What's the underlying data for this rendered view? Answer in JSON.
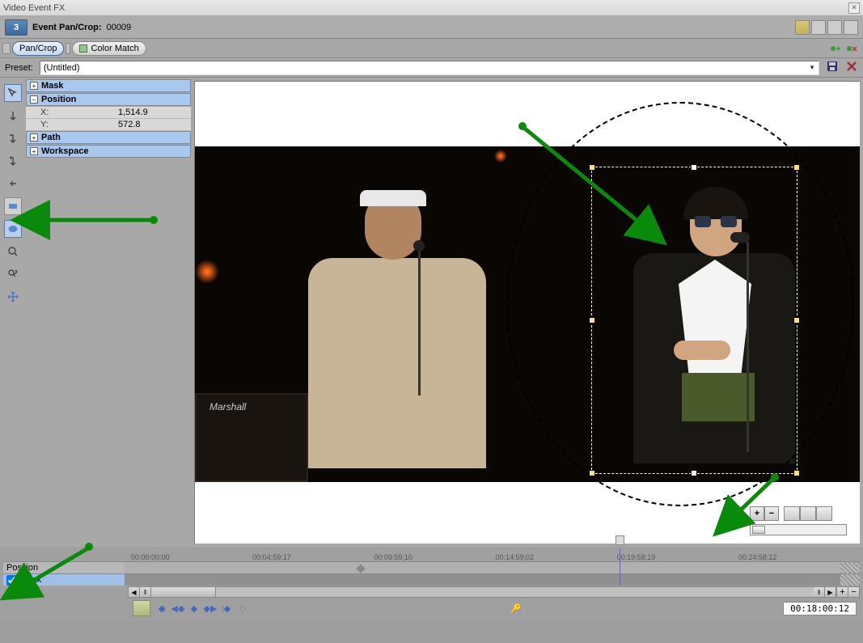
{
  "title": "Video Event FX",
  "header": {
    "label": "Event Pan/Crop:",
    "frame": "00009",
    "layer_badge": "3"
  },
  "chain": {
    "pancrop": "Pan/Crop",
    "colormatch": "Color Match"
  },
  "preset": {
    "label": "Preset:",
    "value": "(Untitled)"
  },
  "props": {
    "mask": "Mask",
    "position": "Position",
    "x_label": "X:",
    "x_value": "1,514.9",
    "y_label": "Y:",
    "y_value": "572.8",
    "path": "Path",
    "workspace": "Workspace"
  },
  "amp_brand": "Marshall",
  "timeline": {
    "ticks": [
      "00:00:00:00",
      "00:04:59;17",
      "00:09:59;10",
      "00:14:59;02",
      "00:19:58;19",
      "00:24:58;12"
    ],
    "tracks": {
      "position": "Position",
      "mask": "Mask"
    }
  },
  "bottom": {
    "current_time": "00:18:00:12"
  }
}
